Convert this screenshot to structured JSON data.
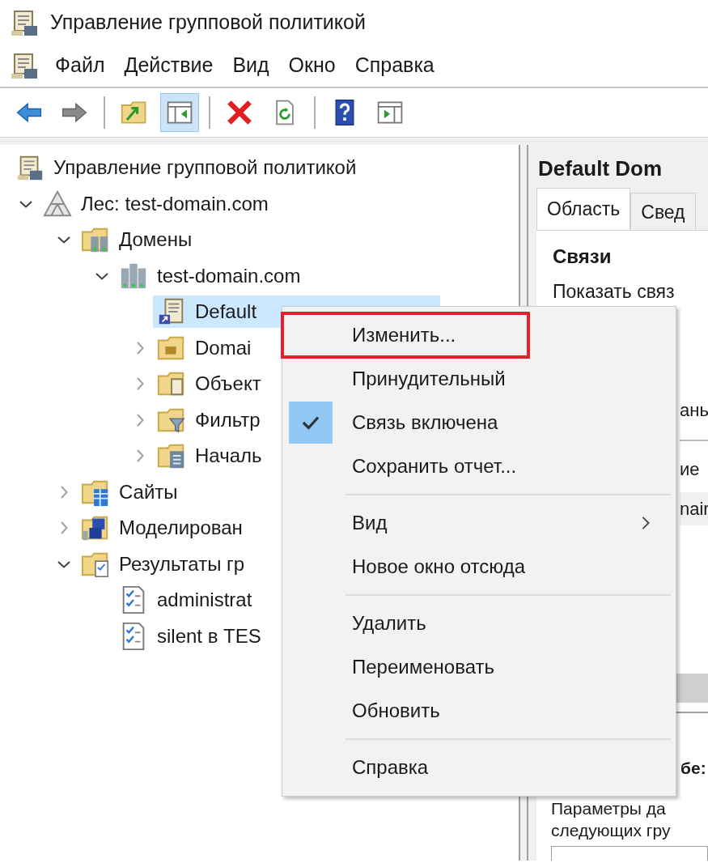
{
  "window": {
    "title": "Управление групповой политикой"
  },
  "menu_bar": [
    "Файл",
    "Действие",
    "Вид",
    "Окно",
    "Справка"
  ],
  "toolbar": [
    {
      "kind": "back",
      "pressed": false
    },
    {
      "kind": "forward",
      "pressed": false
    },
    {
      "kind": "separator"
    },
    {
      "kind": "up-folder",
      "pressed": false
    },
    {
      "kind": "console-tree",
      "pressed": true
    },
    {
      "kind": "separator"
    },
    {
      "kind": "delete",
      "pressed": false
    },
    {
      "kind": "refresh",
      "pressed": false
    },
    {
      "kind": "separator"
    },
    {
      "kind": "help",
      "pressed": false
    },
    {
      "kind": "action-pane",
      "pressed": false
    }
  ],
  "tree": [
    {
      "label": "Управление групповой политикой",
      "kind": "console",
      "selected": false,
      "children": [
        {
          "label": "Лес: test-domain.com",
          "kind": "forest",
          "expanded": true,
          "selected": false,
          "children": [
            {
              "label": "Домены",
              "kind": "domains",
              "expanded": true,
              "selected": false,
              "children": [
                {
                  "label": "test-domain.com",
                  "kind": "domain",
                  "expanded": true,
                  "selected": false,
                  "children": [
                    {
                      "label": "Default",
                      "kind": "gpo-link",
                      "selected": true
                    },
                    {
                      "label": "Domai",
                      "kind": "ou",
                      "expanded": false,
                      "selected": false
                    },
                    {
                      "label": "Объект",
                      "kind": "gpo-folder",
                      "expanded": false,
                      "selected": false
                    },
                    {
                      "label": "Фильтр",
                      "kind": "filter-folder",
                      "expanded": false,
                      "selected": false
                    },
                    {
                      "label": "Началь",
                      "kind": "starter-folder",
                      "expanded": false,
                      "selected": false
                    }
                  ]
                }
              ]
            },
            {
              "label": "Сайты",
              "kind": "sites",
              "expanded": false,
              "selected": false
            },
            {
              "label": "Моделирован",
              "kind": "modeling",
              "expanded": false,
              "selected": false
            },
            {
              "label": "Результаты гр",
              "kind": "results",
              "expanded": true,
              "selected": false,
              "children": [
                {
                  "label": "administrat",
                  "kind": "report",
                  "selected": false
                },
                {
                  "label": "silent в TES",
                  "kind": "report",
                  "selected": false
                }
              ]
            }
          ]
        }
      ]
    }
  ],
  "details": {
    "title": "Default Dom",
    "tabs": [
      {
        "label": "Область",
        "selected": true
      },
      {
        "label": "Свед",
        "selected": false
      }
    ],
    "section": "Связи",
    "links_label": "Показать связ",
    "links_value": "ань",
    "table_header": "ие",
    "table_row": "nair",
    "filter_heading": "бе:",
    "filter_text": [
      "Параметры да",
      "следующих гру"
    ]
  },
  "context_menu": [
    {
      "kind": "item",
      "label": "Изменить...",
      "checked": false,
      "outlined": true,
      "submenu": false
    },
    {
      "kind": "item",
      "label": "Принудительный",
      "checked": false,
      "outlined": false,
      "submenu": false
    },
    {
      "kind": "item",
      "label": "Связь включена",
      "checked": true,
      "outlined": false,
      "submenu": false
    },
    {
      "kind": "item",
      "label": "Сохранить отчет...",
      "checked": false,
      "outlined": false,
      "submenu": false
    },
    {
      "kind": "separator"
    },
    {
      "kind": "item",
      "label": "Вид",
      "checked": false,
      "outlined": false,
      "submenu": true
    },
    {
      "kind": "item",
      "label": "Новое окно отсюда",
      "checked": false,
      "outlined": false,
      "submenu": false
    },
    {
      "kind": "separator"
    },
    {
      "kind": "item",
      "label": "Удалить",
      "checked": false,
      "outlined": false,
      "submenu": false
    },
    {
      "kind": "item",
      "label": "Переименовать",
      "checked": false,
      "outlined": false,
      "submenu": false
    },
    {
      "kind": "item",
      "label": "Обновить",
      "checked": false,
      "outlined": false,
      "submenu": false
    },
    {
      "kind": "separator"
    },
    {
      "kind": "item",
      "label": "Справка",
      "checked": false,
      "outlined": false,
      "submenu": false
    }
  ]
}
